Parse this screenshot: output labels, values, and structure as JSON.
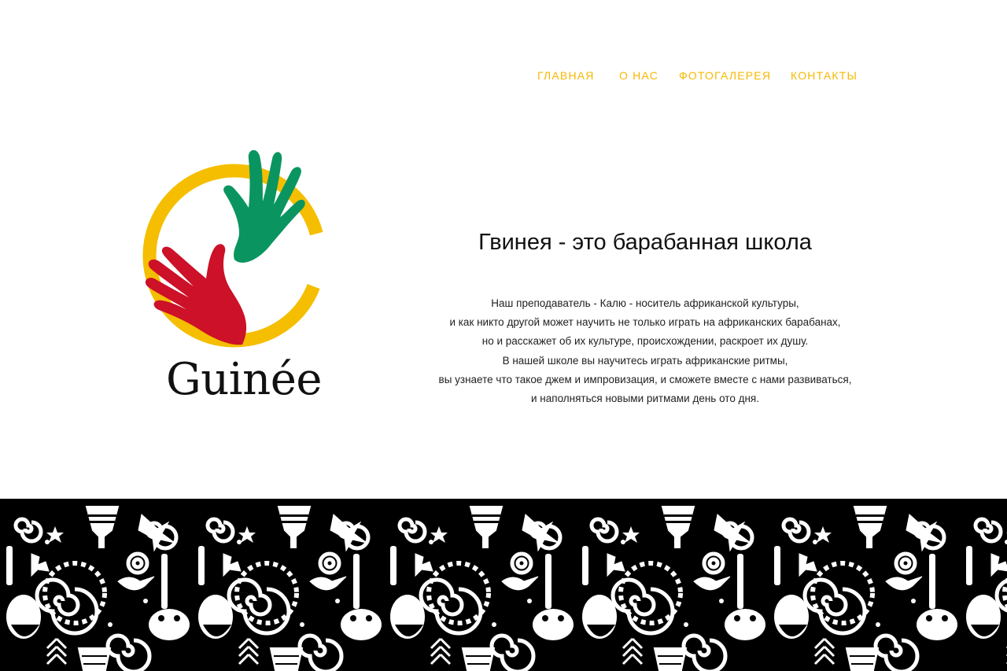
{
  "nav": {
    "items": [
      {
        "label": "ГЛАВНАЯ"
      },
      {
        "label": "О НАС"
      },
      {
        "label": "ФОТОГАЛЕРЕЯ"
      },
      {
        "label": "КОНТАКТЫ"
      }
    ],
    "color": "#f5b800"
  },
  "logo": {
    "wordmark": "Guinée",
    "colors": {
      "ring": "#f5be00",
      "green_hand": "#0a9560",
      "red_hand": "#cc1128"
    }
  },
  "hero": {
    "title": "Гвинея - это барабанная школа",
    "paragraph_lines": [
      "Наш преподаватель - Калю - носитель африканской культуры,",
      "и как никто другой может научить не только играть на африканских барабанах,",
      "но и расскажет об их культуре, происхождении, раскроет их душу.",
      "В нашей школе вы научитесь играть африканские ритмы,",
      "вы узнаете что такое джем и импровизация, и сможете вместе с нами развиваться,",
      "и наполняться новыми ритмами день ото дня."
    ]
  },
  "footer_pattern": {
    "description_icon": "african-ornament-pattern",
    "background": "#000000",
    "foreground": "#ffffff"
  }
}
